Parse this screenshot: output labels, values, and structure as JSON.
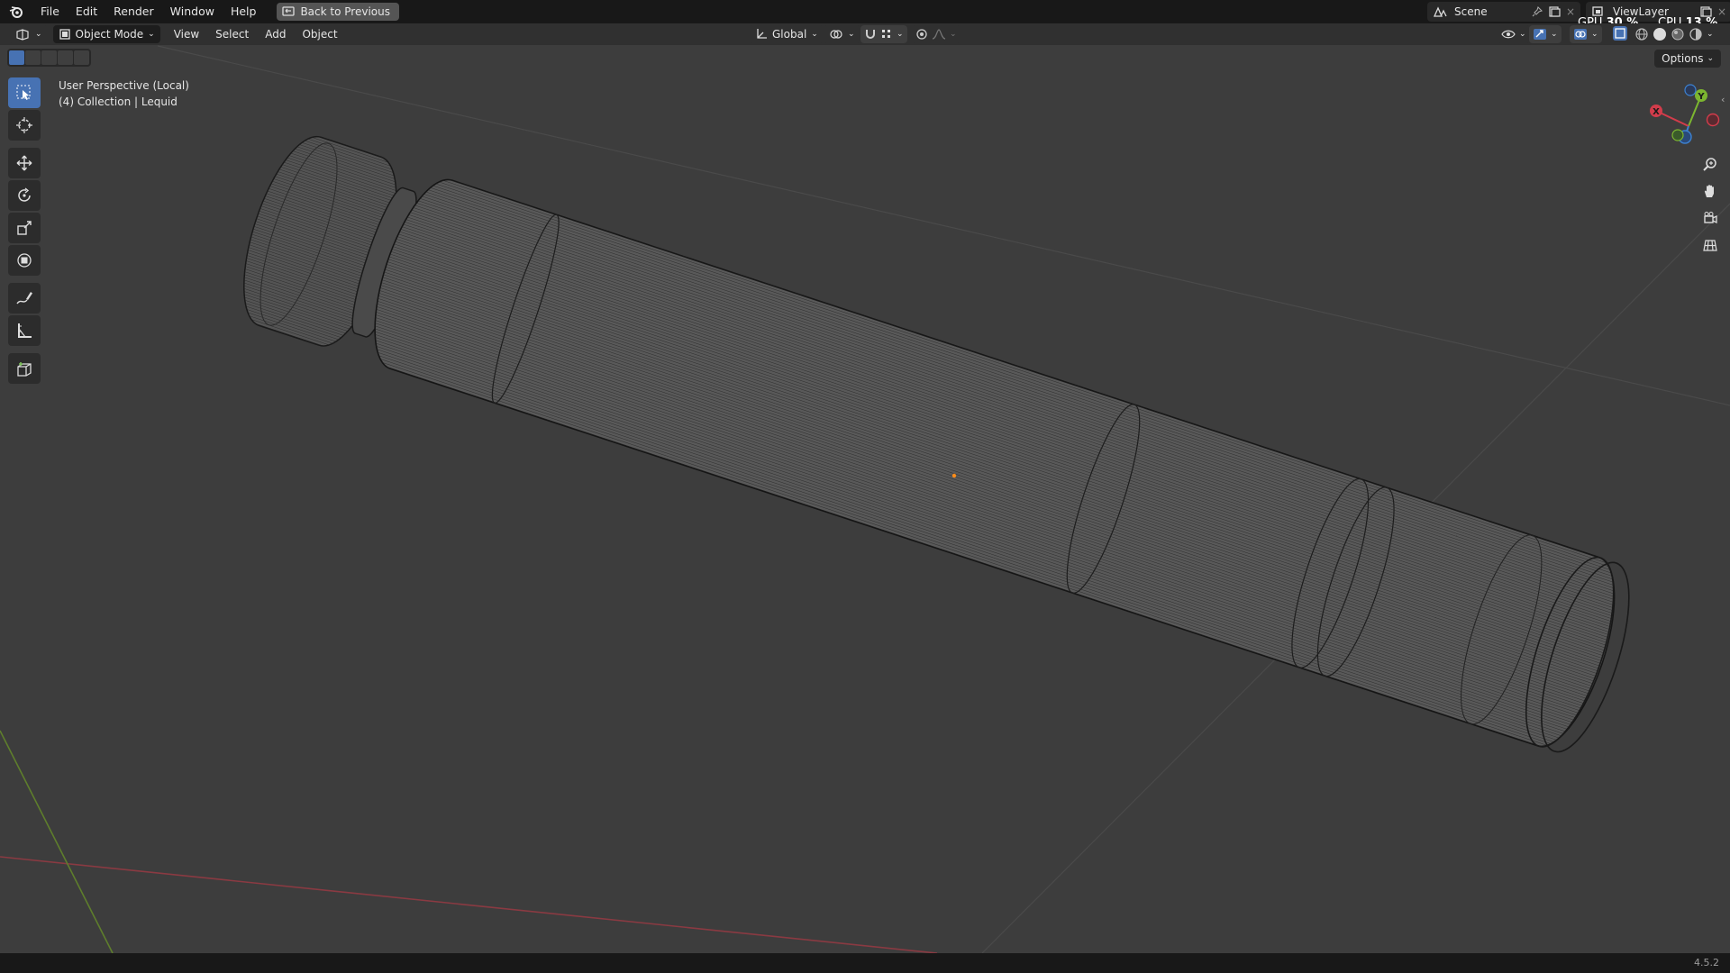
{
  "topbar": {
    "menus": [
      "File",
      "Edit",
      "Render",
      "Window",
      "Help"
    ],
    "back_button": "Back to Previous",
    "scene": "Scene",
    "view_layer": "ViewLayer",
    "gpu_label": "GPU",
    "gpu_value": "30 %",
    "cpu_label": "CPU",
    "cpu_value": "13 %"
  },
  "header": {
    "mode": "Object Mode",
    "menus": [
      "View",
      "Select",
      "Add",
      "Object"
    ],
    "orientation": "Global"
  },
  "toolbar": {
    "tools": [
      "select-box-tool",
      "cursor-tool",
      "move-tool",
      "rotate-tool",
      "scale-tool",
      "transform-tool",
      "annotate-tool",
      "measure-tool",
      "add-cube-tool"
    ]
  },
  "viewport": {
    "perspective": "User Perspective (Local)",
    "collection": "(4) Collection | Lequid",
    "options_label": "Options"
  },
  "gizmo": {
    "x": "X",
    "y": "Y"
  },
  "status": {
    "version": "4.5.2"
  },
  "colors": {
    "accent": "#4772b3",
    "axis_x": "#d23c4b",
    "axis_y": "#7cb630",
    "axis_z": "#3c82d2",
    "origin": "#ff8c1a"
  }
}
